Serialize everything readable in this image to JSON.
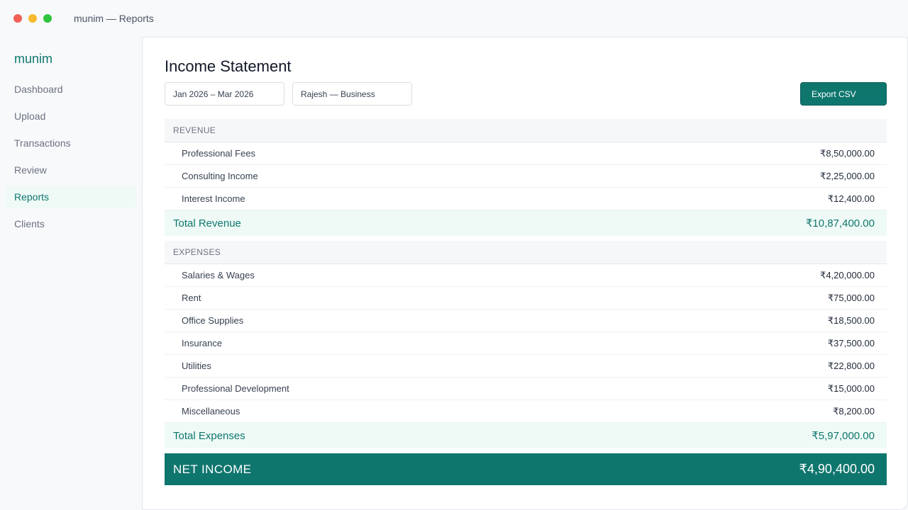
{
  "window": {
    "title": "munim — Reports"
  },
  "sidebar": {
    "brand": "munim",
    "items": [
      {
        "label": "Dashboard",
        "active": false
      },
      {
        "label": "Upload",
        "active": false
      },
      {
        "label": "Transactions",
        "active": false
      },
      {
        "label": "Review",
        "active": false
      },
      {
        "label": "Reports",
        "active": true
      },
      {
        "label": "Clients",
        "active": false
      }
    ]
  },
  "main": {
    "title": "Income Statement",
    "filters": {
      "period": "Jan 2026 – Mar 2026",
      "client": "Rajesh — Business"
    },
    "export_label": "Export CSV"
  },
  "statement": {
    "revenue": {
      "header": "REVENUE",
      "rows": [
        {
          "label": "Professional Fees",
          "amount": "₹8,50,000.00"
        },
        {
          "label": "Consulting Income",
          "amount": "₹2,25,000.00"
        },
        {
          "label": "Interest Income",
          "amount": "₹12,400.00"
        }
      ],
      "total_label": "Total Revenue",
      "total_amount": "₹10,87,400.00"
    },
    "expenses": {
      "header": "EXPENSES",
      "rows": [
        {
          "label": "Salaries & Wages",
          "amount": "₹4,20,000.00"
        },
        {
          "label": "Rent",
          "amount": "₹75,000.00"
        },
        {
          "label": "Office Supplies",
          "amount": "₹18,500.00"
        },
        {
          "label": "Insurance",
          "amount": "₹37,500.00"
        },
        {
          "label": "Utilities",
          "amount": "₹22,800.00"
        },
        {
          "label": "Professional Development",
          "amount": "₹15,000.00"
        },
        {
          "label": "Miscellaneous",
          "amount": "₹8,200.00"
        }
      ],
      "total_label": "Total Expenses",
      "total_amount": "₹5,97,000.00"
    },
    "net": {
      "label": "NET INCOME",
      "amount": "₹4,90,400.00"
    }
  },
  "colors": {
    "accent": "#0f766e",
    "accent_light": "#effaf6"
  }
}
